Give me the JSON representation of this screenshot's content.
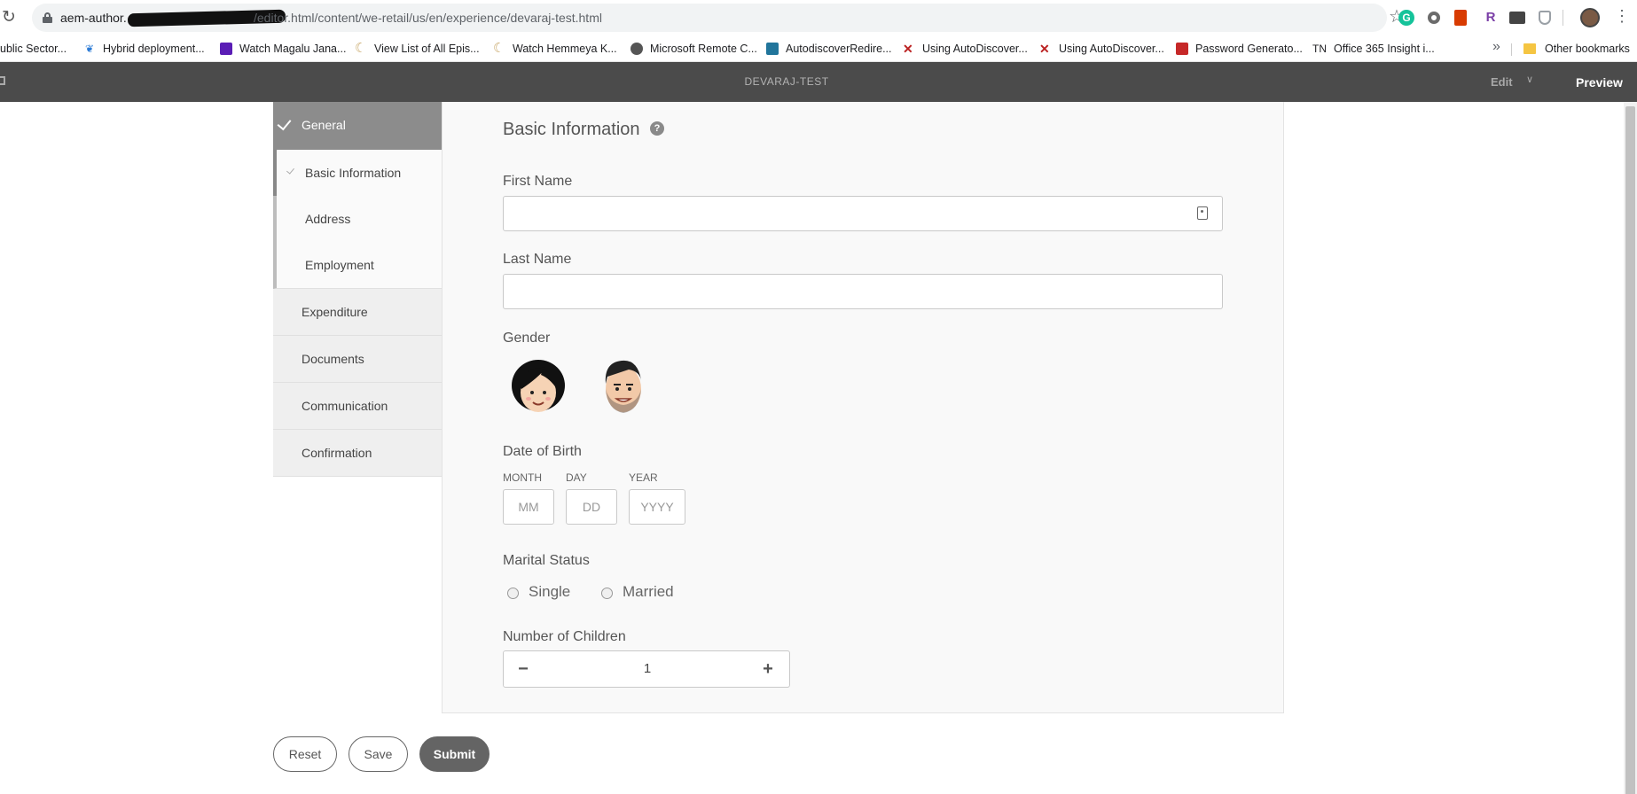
{
  "browser": {
    "url_host": "aem-author.",
    "url_path": "/editor.html/content/we-retail/us/en/experience/devaraj-test.html",
    "bookmarks": [
      {
        "label": "ublic Sector...",
        "icon": "public-sector-icon"
      },
      {
        "label": "Hybrid deployment...",
        "icon": "hybrid-icon"
      },
      {
        "label": "Watch Magalu Jana...",
        "icon": "voot-icon"
      },
      {
        "label": "View List of All Epis...",
        "icon": "moon-icon"
      },
      {
        "label": "Watch Hemmeya K...",
        "icon": "moon-icon"
      },
      {
        "label": "Microsoft Remote C...",
        "icon": "globe-icon"
      },
      {
        "label": "AutodiscoverRedire...",
        "icon": "wordpress-icon"
      },
      {
        "label": "Using AutoDiscover...",
        "icon": "x-icon"
      },
      {
        "label": "Using AutoDiscover...",
        "icon": "x-icon"
      },
      {
        "label": "Password Generato...",
        "icon": "password-icon"
      },
      {
        "label": "Office 365 Insight i...",
        "icon": "tn-icon",
        "prefix": "TN"
      }
    ],
    "other_bookmarks": "Other bookmarks",
    "more": "»",
    "grammarly_letter": "G",
    "ext_r_letter": "R"
  },
  "editor": {
    "page_title": "DEVARAJ-TEST",
    "edit_label": "Edit",
    "preview_label": "Preview"
  },
  "nav": {
    "active": "General",
    "sub_items": [
      "Basic Information",
      "Address",
      "Employment"
    ],
    "items": [
      "Expenditure",
      "Documents",
      "Communication",
      "Confirmation"
    ]
  },
  "form": {
    "section_title": "Basic Information",
    "help_glyph": "?",
    "first_name_label": "First Name",
    "first_name_value": "",
    "last_name_label": "Last Name",
    "last_name_value": "",
    "gender_label": "Gender",
    "dob_label": "Date of Birth",
    "dob": {
      "month_label": "MONTH",
      "month_placeholder": "MM",
      "day_label": "DAY",
      "day_placeholder": "DD",
      "year_label": "YEAR",
      "year_placeholder": "YYYY"
    },
    "marital_label": "Marital Status",
    "marital_options": [
      "Single",
      "Married"
    ],
    "children_label": "Number of Children",
    "children_value": "1",
    "minus": "−",
    "plus": "+"
  },
  "actions": {
    "reset": "Reset",
    "save": "Save",
    "submit": "Submit"
  }
}
